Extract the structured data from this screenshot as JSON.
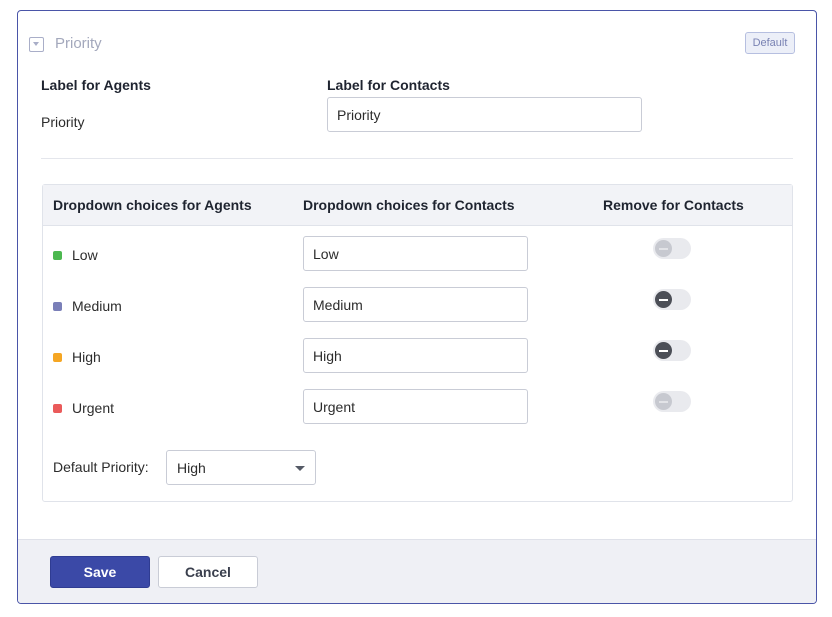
{
  "field": {
    "title": "Priority",
    "badge": "Default",
    "icon": "collapse-caret-icon"
  },
  "labels": {
    "agents_heading": "Label for Agents",
    "agents_value": "Priority",
    "contacts_heading": "Label for Contacts",
    "contacts_value": "Priority"
  },
  "choices": {
    "headers": {
      "agents": "Dropdown choices for Agents",
      "contacts": "Dropdown choices for Contacts",
      "remove": "Remove for Contacts"
    },
    "rows": [
      {
        "agent_label": "Low",
        "contact_label": "Low",
        "color": "#4cb84f",
        "remove_toggle": "disabled"
      },
      {
        "agent_label": "Medium",
        "contact_label": "Medium",
        "color": "#7a7fb8",
        "remove_toggle": "enabled"
      },
      {
        "agent_label": "High",
        "contact_label": "High",
        "color": "#f5a623",
        "remove_toggle": "enabled"
      },
      {
        "agent_label": "Urgent",
        "contact_label": "Urgent",
        "color": "#ea5a5a",
        "remove_toggle": "disabled"
      }
    ],
    "default_priority_label": "Default Priority:",
    "default_priority_value": "High"
  },
  "footer": {
    "save_label": "Save",
    "cancel_label": "Cancel"
  },
  "colors": {
    "accent": "#3b49a7",
    "border": "#4a55a8"
  }
}
